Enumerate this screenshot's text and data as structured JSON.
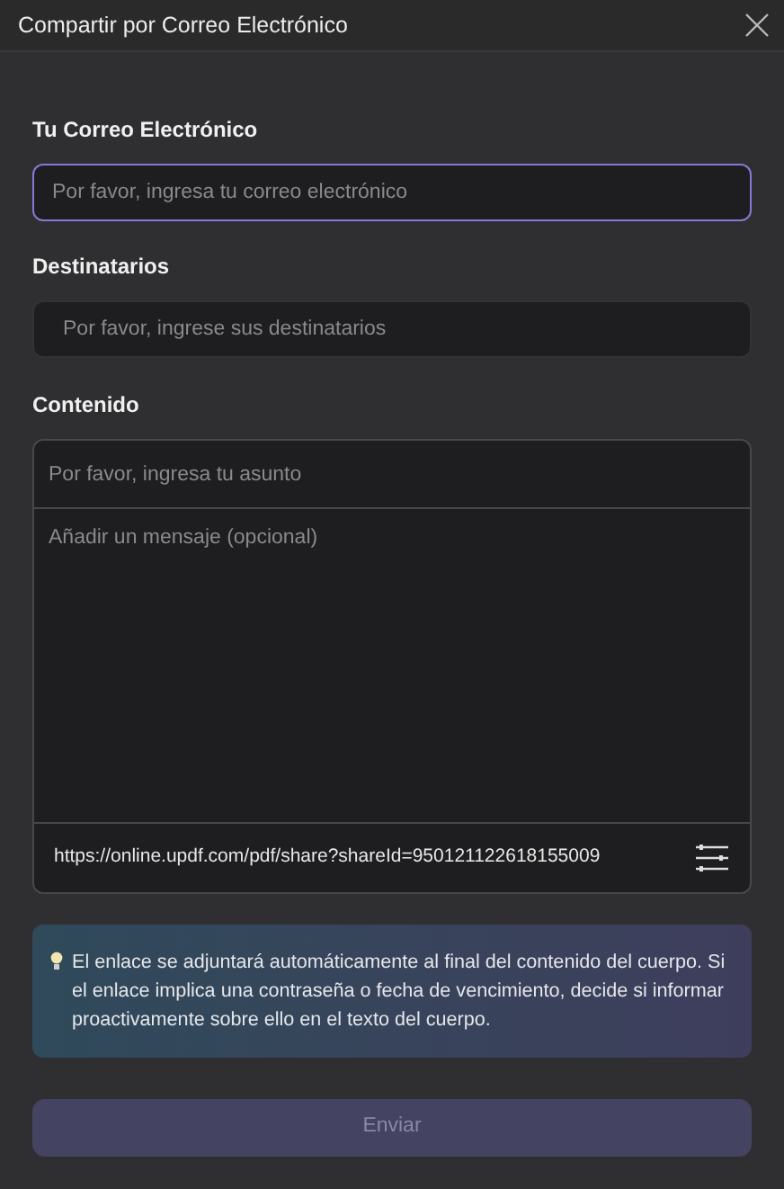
{
  "window": {
    "title": "Compartir por Correo Electrónico"
  },
  "email": {
    "label": "Tu Correo Electrónico",
    "placeholder": "Por favor, ingresa tu correo electrónico",
    "focused": true
  },
  "recipients": {
    "label": "Destinatarios",
    "placeholder": "Por favor, ingrese sus destinatarios",
    "focused": false
  },
  "content": {
    "label": "Contenido",
    "subject_placeholder": "Por favor, ingresa tu asunto",
    "message_placeholder": "Añadir un mensaje (opcional)",
    "link": "https://online.updf.com/pdf/share?shareId=950121122618155009"
  },
  "notice": "El enlace se adjuntará automáticamente al final del contenido del cuerpo. Si el enlace implica una contraseña o fecha de vencimiento, decide si informar proactivamente sobre ello en el texto del cuerpo.",
  "send_button": {
    "label": "Enviar",
    "disabled": true
  }
}
